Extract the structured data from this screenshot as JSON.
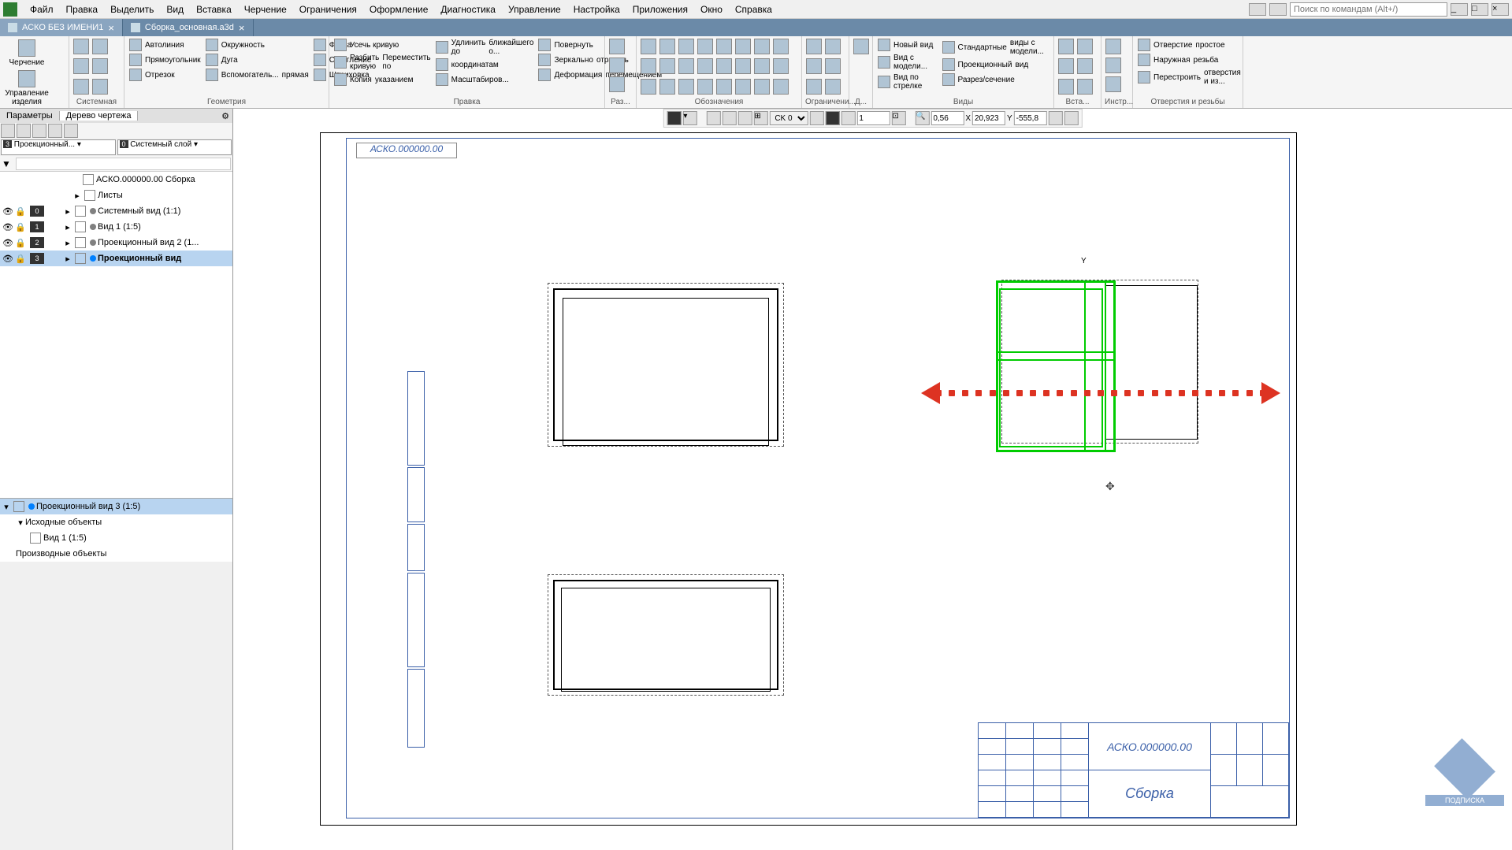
{
  "menu": {
    "items": [
      "Файл",
      "Правка",
      "Выделить",
      "Вид",
      "Вставка",
      "Черчение",
      "Ограничения",
      "Оформление",
      "Диагностика",
      "Управление",
      "Настройка",
      "Приложения",
      "Окно",
      "Справка"
    ],
    "search_placeholder": "Поиск по командам (Alt+/)"
  },
  "tabs": [
    {
      "label": "АСКО БЕЗ ИМЕНИ1",
      "active": true
    },
    {
      "label": "Сборка_основная.a3d",
      "active": false
    }
  ],
  "ribbon": {
    "g1": {
      "label": "Черчение",
      "btns": [
        "Управление",
        "изделия"
      ]
    },
    "g2": {
      "footer": "Системная"
    },
    "geometry": {
      "footer": "Геометрия",
      "items": [
        "Автолиния",
        "Окружность",
        "Фаска",
        "Прямоугольник",
        "Дуга",
        "Скругление",
        "Отрезок",
        "Вспомогатель...",
        "прямая",
        "Штриховка"
      ]
    },
    "edit": {
      "footer": "Правка",
      "items": [
        "Усечь кривую",
        "Удлинить до",
        "ближайшего о...",
        "Разбить кривую",
        "Переместить по",
        "координатам",
        "Повернуть",
        "Зеркально",
        "отразить",
        "Копия",
        "указанием",
        "Масштабиров...",
        "Деформация",
        "перемещением"
      ]
    },
    "dims": {
      "footer": "Раз..."
    },
    "annot": {
      "footer": "Обозначения"
    },
    "constr": {
      "footer": "Ограничени..."
    },
    "diag": {
      "footer": "Д..."
    },
    "views": {
      "footer": "Виды",
      "items": [
        "Новый вид",
        "Стандартные",
        "виды с модели...",
        "Вид с модели...",
        "Проекционный",
        "вид",
        "Вид по стрелке",
        "Разрез/сечение"
      ]
    },
    "insert": {
      "footer": "Вста..."
    },
    "tools": {
      "footer": "Инстр..."
    },
    "holes": {
      "footer": "Отверстия и резьбы",
      "items": [
        "Отверстие",
        "простое",
        "Наружная",
        "резьба",
        "Перестроить",
        "отверстия и из..."
      ]
    }
  },
  "panel": {
    "tab1": "Параметры",
    "tab2": "Дерево чертежа",
    "layer_combo1": "Проекционный...",
    "layer_combo2": "Системный слой",
    "root": "АСКО.000000.00 Сборка",
    "rows": [
      {
        "label": "Листы"
      },
      {
        "num": "0",
        "label": "Системный вид (1:1)",
        "dot": "#808080"
      },
      {
        "num": "1",
        "label": "Вид 1 (1:5)",
        "dot": "#808080"
      },
      {
        "num": "2",
        "label": "Проекционный вид 2 (1...",
        "dot": "#808080"
      },
      {
        "num": "3",
        "label": "Проекционный вид",
        "dot": "#0080ff",
        "selected": true
      }
    ],
    "lower": {
      "root": "Проекционный вид 3 (1:5)",
      "items": [
        "Исходные объекты",
        "Вид 1 (1:5)",
        "Производные объекты"
      ]
    }
  },
  "canvas_tb": {
    "coord_label": "CK 0",
    "scale_val": "1",
    "zoom": "0,56",
    "x_label": "X",
    "x_val": "20,923",
    "y_label": "Y",
    "y_val": "-555,8"
  },
  "sheet": {
    "label": "АСКО.000000.00",
    "y_axis": "Y",
    "titleblock": {
      "code": "АСКО.000000.00",
      "name": "Сборка"
    }
  },
  "watermark": "ПОДПИСКА"
}
